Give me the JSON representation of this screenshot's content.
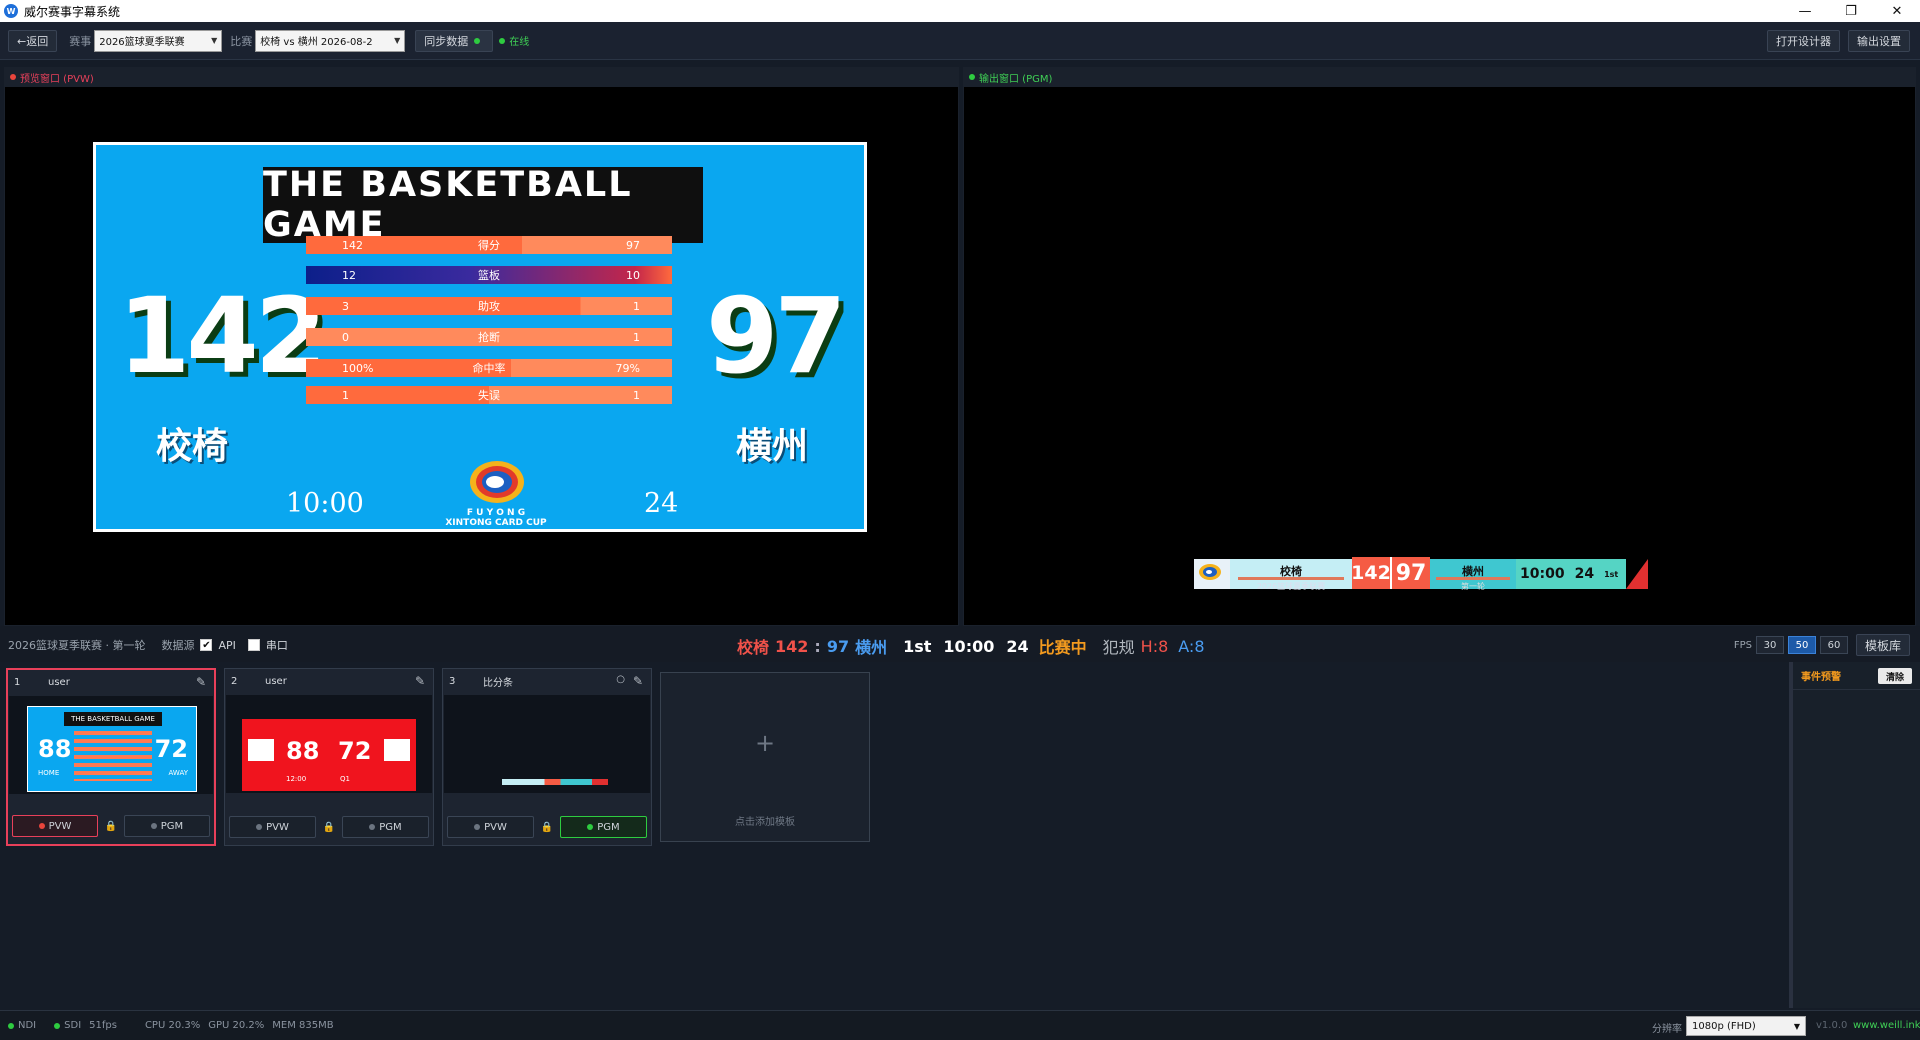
{
  "window": {
    "title": "威尔赛事字幕系统",
    "minimize": "—",
    "maximize": "❐",
    "close": "✕"
  },
  "toolbar": {
    "back": "←返回",
    "event_label": "赛事",
    "event_value": "2026篮球夏季联赛",
    "match_label": "比赛",
    "match_value": "校椅 vs 横州  2026-08-2",
    "sync": "同步数据",
    "online": "在线",
    "open_designer": "打开设计器",
    "output_settings": "输出设置"
  },
  "preview": {
    "title": "预览窗口 (PVW)",
    "scoreboard": {
      "title": "THE  BASKETBALL  GAME",
      "home_score": "142",
      "away_score": "97",
      "home_team": "校椅",
      "away_team": "横州",
      "clock": "10:00",
      "shot_clock": "24",
      "logo_text_1": "F U Y O N G",
      "logo_text_2": "XINTONG CARD CUP",
      "stats": [
        {
          "label": "得分",
          "home": "142",
          "away": "97",
          "home_share": 0.59
        },
        {
          "label": "篮板",
          "home": "12",
          "away": "10",
          "home_share": 0.55
        },
        {
          "label": "助攻",
          "home": "3",
          "away": "1",
          "home_share": 0.75
        },
        {
          "label": "抢断",
          "home": "0",
          "away": "1",
          "home_share": 0.0
        },
        {
          "label": "命中率",
          "home": "100%",
          "away": "79%",
          "home_share": 0.56
        },
        {
          "label": "失误",
          "home": "1",
          "away": "1",
          "home_share": 0.5
        }
      ]
    }
  },
  "program": {
    "title": "输出窗口 (PGM)",
    "lower_third": {
      "home_team": "校椅",
      "home_score": "142",
      "away_score": "97",
      "away_team": "横州",
      "clock": "10:00",
      "shot_clock": "24",
      "period": "1st",
      "league": "2026篮球夏季联赛",
      "round": "第一轮"
    }
  },
  "strip": {
    "context": "2026篮球夏季联赛 · 第一轮",
    "datasource_label": "数据源",
    "api_label": "API",
    "api_checked": true,
    "serial_label": "串口",
    "serial_checked": false,
    "home_team": "校椅",
    "home_score": "142",
    "sep": ":",
    "away_score": "97",
    "away_team": "横州",
    "period": "1st",
    "clock": "10:00",
    "shot_clock": "24",
    "state": "比赛中",
    "fouls_label": "犯规",
    "home_fouls": "H:8",
    "away_fouls": "A:8",
    "fps_label": "FPS",
    "fps_options": [
      "30",
      "50",
      "60"
    ],
    "fps_selected": "50",
    "library": "模板库"
  },
  "templates": [
    {
      "num": "1",
      "name": "user",
      "home": "88",
      "away": "72",
      "home_label": "HOME",
      "away_label": "AWAY",
      "title": "THE BASKETBALL GAME",
      "pvw": "PVW",
      "pgm": "PGM"
    },
    {
      "num": "2",
      "name": "user",
      "home": "88",
      "away": "72",
      "clock": "12:00",
      "period": "Q1",
      "pvw": "PVW",
      "pgm": "PGM"
    },
    {
      "num": "3",
      "name": "比分条",
      "pvw": "PVW",
      "pgm": "PGM"
    }
  ],
  "add_template": {
    "plus": "+",
    "hint": "点击添加模板"
  },
  "event_panel": {
    "title": "事件预警",
    "clear": "清除"
  },
  "statusbar": {
    "ndi": "NDI",
    "sdi": "SDI",
    "fps": "51fps",
    "cpu": "CPU 20.3%",
    "gpu": "GPU 20.2%",
    "mem": "MEM 835MB",
    "res_label": "分辨率",
    "res_value": "1080p (FHD)",
    "version": "v1.0.0",
    "site": "www.weill.ink"
  },
  "colors": {
    "accent_red": "#e8405a",
    "online_green": "#2ecc40",
    "scoreboard_blue": "#0aa7f0",
    "stat_orange": "#ff6a3d",
    "state_orange": "#f39a1e"
  }
}
